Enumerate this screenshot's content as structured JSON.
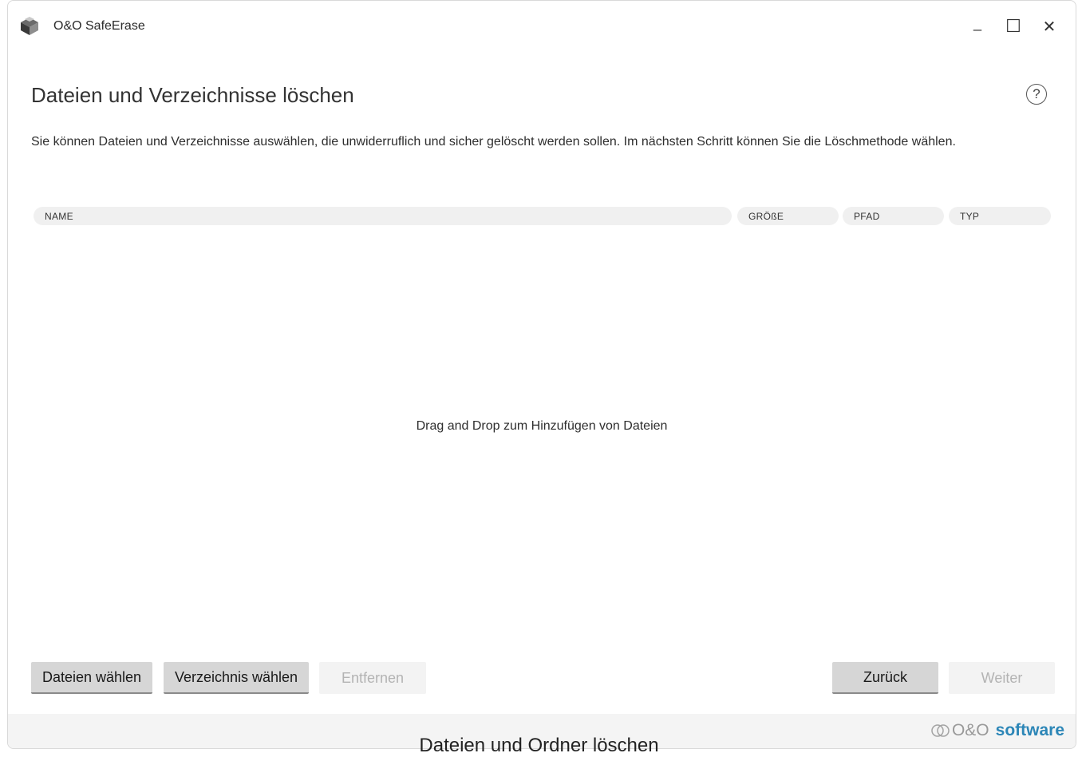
{
  "window": {
    "title": "O&O SafeErase",
    "minimize_glyph": "_",
    "maximize_glyph": "☐",
    "close_glyph": "✕"
  },
  "page": {
    "title": "Dateien und Verzeichnisse löschen",
    "help_glyph": "?",
    "description": "Sie können Dateien und Verzeichnisse auswählen, die unwiderruflich und sicher gelöscht werden sollen. Im nächsten Schritt können Sie die Löschmethode wählen."
  },
  "table": {
    "columns": [
      "NAME",
      "GRÖßE",
      "PFAD",
      "TYP"
    ],
    "empty_hint": "Drag and Drop zum Hinzufügen von Dateien"
  },
  "buttons": {
    "choose_files": "Dateien wählen",
    "choose_folder": "Verzeichnis wählen",
    "remove": "Entfernen",
    "back": "Zurück",
    "next": "Weiter"
  },
  "footer": {
    "brand_prefix": "O&O",
    "brand_name": "software",
    "caption": "Dateien und Ordner löschen"
  },
  "colors": {
    "accent": "#2c86b7",
    "button_active": "#d6d6d6",
    "button_disabled": "#f3f3f3"
  }
}
